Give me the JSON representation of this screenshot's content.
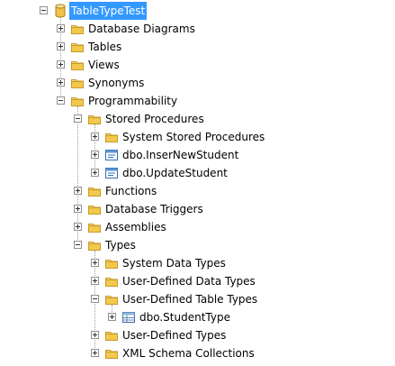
{
  "tree": {
    "nodes": [
      {
        "label": "TableTypeTest",
        "level": 0,
        "expander": "minus",
        "icon": "database-icon",
        "selected": true
      },
      {
        "label": "Database Diagrams",
        "level": 1,
        "expander": "plus",
        "icon": "folder-icon"
      },
      {
        "label": "Tables",
        "level": 1,
        "expander": "plus",
        "icon": "folder-icon"
      },
      {
        "label": "Views",
        "level": 1,
        "expander": "plus",
        "icon": "folder-icon"
      },
      {
        "label": "Synonyms",
        "level": 1,
        "expander": "plus",
        "icon": "folder-icon"
      },
      {
        "label": "Programmability",
        "level": 1,
        "expander": "minus",
        "icon": "folder-icon"
      },
      {
        "label": "Stored Procedures",
        "level": 2,
        "expander": "minus",
        "icon": "folder-icon"
      },
      {
        "label": "System Stored Procedures",
        "level": 3,
        "expander": "plus",
        "icon": "folder-icon"
      },
      {
        "label": "dbo.InserNewStudent",
        "level": 3,
        "expander": "plus",
        "icon": "stored-procedure-icon"
      },
      {
        "label": "dbo.UpdateStudent",
        "level": 3,
        "expander": "plus",
        "icon": "stored-procedure-icon"
      },
      {
        "label": "Functions",
        "level": 2,
        "expander": "plus",
        "icon": "folder-icon"
      },
      {
        "label": "Database Triggers",
        "level": 2,
        "expander": "plus",
        "icon": "folder-icon"
      },
      {
        "label": "Assemblies",
        "level": 2,
        "expander": "plus",
        "icon": "folder-icon"
      },
      {
        "label": "Types",
        "level": 2,
        "expander": "minus",
        "icon": "folder-icon"
      },
      {
        "label": "System Data Types",
        "level": 3,
        "expander": "plus",
        "icon": "folder-icon"
      },
      {
        "label": "User-Defined Data Types",
        "level": 3,
        "expander": "plus",
        "icon": "folder-icon"
      },
      {
        "label": "User-Defined Table Types",
        "level": 3,
        "expander": "minus",
        "icon": "folder-icon"
      },
      {
        "label": "dbo.StudentType",
        "level": 4,
        "expander": "plus",
        "icon": "table-type-icon"
      },
      {
        "label": "User-Defined Types",
        "level": 3,
        "expander": "plus",
        "icon": "folder-icon"
      },
      {
        "label": "XML Schema Collections",
        "level": 3,
        "expander": "plus",
        "icon": "folder-icon"
      }
    ]
  },
  "colors": {
    "selection": "#3399ff",
    "folder": "#f2c94c",
    "database": "#e8b73a",
    "procedure": "#3a78c2"
  }
}
